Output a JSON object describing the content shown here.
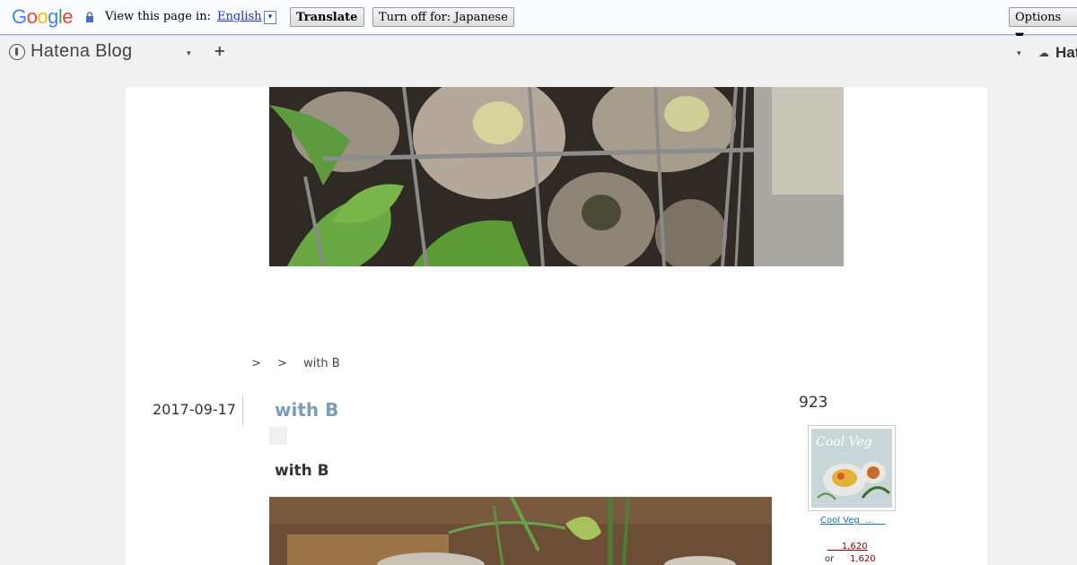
{
  "translate_bar": {
    "logo": "Google",
    "view_label": "View this page in:",
    "language": "English",
    "language_arrow": "▾",
    "translate_button": "Translate",
    "turn_off_button": "Turn off for: Japanese",
    "options_button": "Options ▼"
  },
  "hatena_bar": {
    "logo_text": "Hatena Blog",
    "dropdown": "▾",
    "add": "+",
    "right_dropdown": "▾",
    "right_label": "Hat"
  },
  "breadcrumb": {
    "sep1": ">",
    "sep2": ">",
    "current": "with B"
  },
  "entry": {
    "date": "2017-09-17",
    "title": "with B",
    "subheading": "with B"
  },
  "sidebar": {
    "count": "923",
    "book_cover_title": "Cool Veg",
    "book_link": "Cool Veg  ...    ",
    "price_1": "     1,620",
    "price_or": "or",
    "price_2": "1,620"
  },
  "colors": {
    "title": "#7f9cb6",
    "link": "#1a6fb5",
    "price": "#8b0000"
  }
}
